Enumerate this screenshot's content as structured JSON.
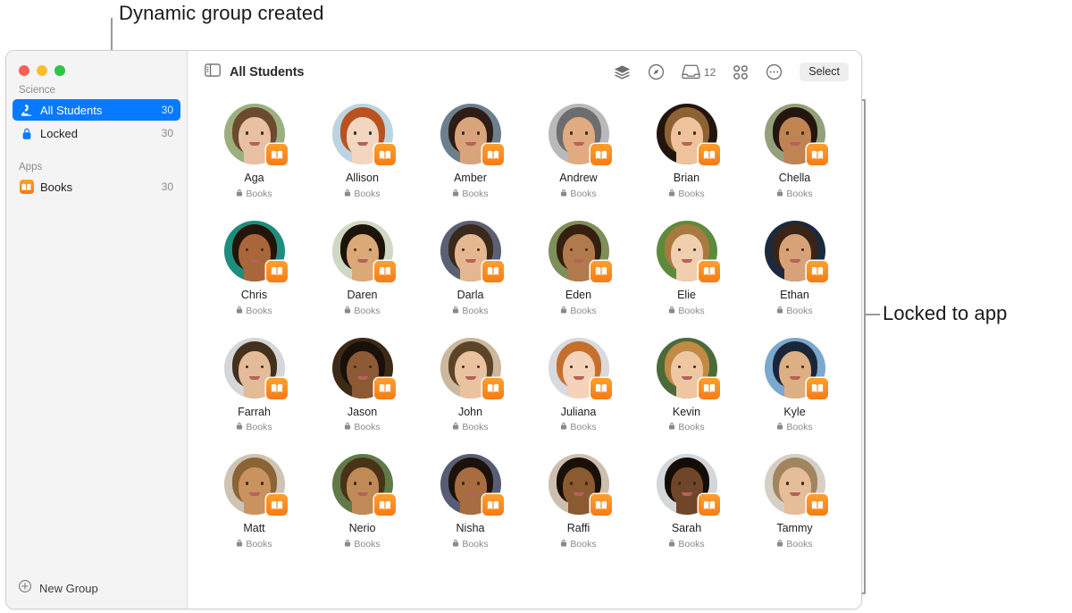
{
  "annotations": {
    "top": "Dynamic group created",
    "right": "Locked to app"
  },
  "window": {
    "traffic_lights": [
      "close-red",
      "minimize-yellow",
      "zoom-green"
    ]
  },
  "sidebar": {
    "sections": [
      {
        "title": "Science",
        "items": [
          {
            "icon": "microscope-icon",
            "label": "All Students",
            "count": "30",
            "selected": true
          },
          {
            "icon": "lock-icon",
            "label": "Locked",
            "count": "30",
            "selected": false
          }
        ]
      },
      {
        "title": "Apps",
        "items": [
          {
            "icon": "books-app-icon",
            "label": "Books",
            "count": "30",
            "selected": false
          }
        ]
      }
    ],
    "footer": {
      "icon": "plus-circle-icon",
      "label": "New Group"
    }
  },
  "toolbar": {
    "sidebar_toggle_icon": "sidebar-toggle-icon",
    "title": "All Students",
    "actions": [
      {
        "icon": "layers-icon",
        "label": ""
      },
      {
        "icon": "compass-icon",
        "label": ""
      },
      {
        "icon": "inbox-tray-icon",
        "label": "12"
      },
      {
        "icon": "grid-view-icon",
        "label": ""
      },
      {
        "icon": "more-ellipsis-icon",
        "label": ""
      }
    ],
    "select_label": "Select"
  },
  "colors": {
    "accent_blue": "#077aff",
    "books_orange": "#f57c16",
    "sidebar_bg": "#f4f4f4",
    "traffic_red": "#ff5f57",
    "traffic_yellow": "#febc2e",
    "traffic_green": "#28c840",
    "muted_text": "#8a8a8e"
  },
  "students": [
    {
      "name": "Aga",
      "status": "Books",
      "locked": true,
      "badge": "books-badge-icon",
      "skin": "#e8c0a2",
      "hair": "#6b4a2f",
      "bg": "#9bb07e"
    },
    {
      "name": "Allison",
      "status": "Books",
      "locked": true,
      "badge": "books-badge-icon",
      "skin": "#f3d6c0",
      "hair": "#b8521f",
      "bg": "#bcd4e0"
    },
    {
      "name": "Amber",
      "status": "Books",
      "locked": true,
      "badge": "books-badge-icon",
      "skin": "#d9a47c",
      "hair": "#2e1d15",
      "bg": "#6d7f8d"
    },
    {
      "name": "Andrew",
      "status": "Books",
      "locked": true,
      "badge": "books-badge-icon",
      "skin": "#e0ab80",
      "hair": "#6d6d70",
      "bg": "#b9b9bb"
    },
    {
      "name": "Brian",
      "status": "Books",
      "locked": true,
      "badge": "books-badge-icon",
      "skin": "#eec39c",
      "hair": "#8d6233",
      "bg": "#23150e"
    },
    {
      "name": "Chella",
      "status": "Books",
      "locked": true,
      "badge": "books-badge-icon",
      "skin": "#c08352",
      "hair": "#24160e",
      "bg": "#93a07c"
    },
    {
      "name": "Chris",
      "status": "Books",
      "locked": true,
      "badge": "books-badge-icon",
      "skin": "#a9663a",
      "hair": "#241409",
      "bg": "#1e8d7e"
    },
    {
      "name": "Daren",
      "status": "Books",
      "locked": true,
      "badge": "books-badge-icon",
      "skin": "#dba878",
      "hair": "#1d1409",
      "bg": "#cfd8c2"
    },
    {
      "name": "Darla",
      "status": "Books",
      "locked": true,
      "badge": "books-badge-icon",
      "skin": "#e5b791",
      "hair": "#3a2a1c",
      "bg": "#5b6072"
    },
    {
      "name": "Eden",
      "status": "Books",
      "locked": true,
      "badge": "books-badge-icon",
      "skin": "#b07a4c",
      "hair": "#35200f",
      "bg": "#7e8f5a"
    },
    {
      "name": "Elie",
      "status": "Books",
      "locked": true,
      "badge": "books-badge-icon",
      "skin": "#f0cfae",
      "hair": "#a97a3f",
      "bg": "#5e8a3c"
    },
    {
      "name": "Ethan",
      "status": "Books",
      "locked": true,
      "badge": "books-badge-icon",
      "skin": "#d8a279",
      "hair": "#3b2415",
      "bg": "#1d2a3d"
    },
    {
      "name": "Farrah",
      "status": "Books",
      "locked": true,
      "badge": "books-badge-icon",
      "skin": "#e3bb99",
      "hair": "#44301e",
      "bg": "#d4d6d9"
    },
    {
      "name": "Jason",
      "status": "Books",
      "locked": true,
      "badge": "books-badge-icon",
      "skin": "#8c5a34",
      "hair": "#19100a",
      "bg": "#3b2a16"
    },
    {
      "name": "John",
      "status": "Books",
      "locked": true,
      "badge": "books-badge-icon",
      "skin": "#e9c2a0",
      "hair": "#5c4428",
      "bg": "#cbb89e"
    },
    {
      "name": "Juliana",
      "status": "Books",
      "locked": true,
      "badge": "books-badge-icon",
      "skin": "#f4d3ba",
      "hair": "#c4702c",
      "bg": "#d8dadd"
    },
    {
      "name": "Kevin",
      "status": "Books",
      "locked": true,
      "badge": "books-badge-icon",
      "skin": "#eec7a2",
      "hair": "#c28a45",
      "bg": "#4b6a3a"
    },
    {
      "name": "Kyle",
      "status": "Books",
      "locked": true,
      "badge": "books-badge-icon",
      "skin": "#ddb083",
      "hair": "#1b2638",
      "bg": "#7ba8cd"
    },
    {
      "name": "Matt",
      "status": "Books",
      "locked": true,
      "badge": "books-badge-icon",
      "skin": "#c9925f",
      "hair": "#8a6434",
      "bg": "#cfc3b2"
    },
    {
      "name": "Nerio",
      "status": "Books",
      "locked": true,
      "badge": "books-badge-icon",
      "skin": "#c08a57",
      "hair": "#4a3219",
      "bg": "#5f7a46"
    },
    {
      "name": "Nisha",
      "status": "Books",
      "locked": true,
      "badge": "books-badge-icon",
      "skin": "#a76d41",
      "hair": "#1d1209",
      "bg": "#575d75"
    },
    {
      "name": "Raffi",
      "status": "Books",
      "locked": true,
      "badge": "books-badge-icon",
      "skin": "#8a5a30",
      "hair": "#1a1008",
      "bg": "#cdbfae"
    },
    {
      "name": "Sarah",
      "status": "Books",
      "locked": true,
      "badge": "books-badge-icon",
      "skin": "#6f462a",
      "hair": "#140c06",
      "bg": "#d3d7da"
    },
    {
      "name": "Tammy",
      "status": "Books",
      "locked": true,
      "badge": "books-badge-icon",
      "skin": "#e6bd99",
      "hair": "#a2855f",
      "bg": "#d6cfc6"
    }
  ]
}
